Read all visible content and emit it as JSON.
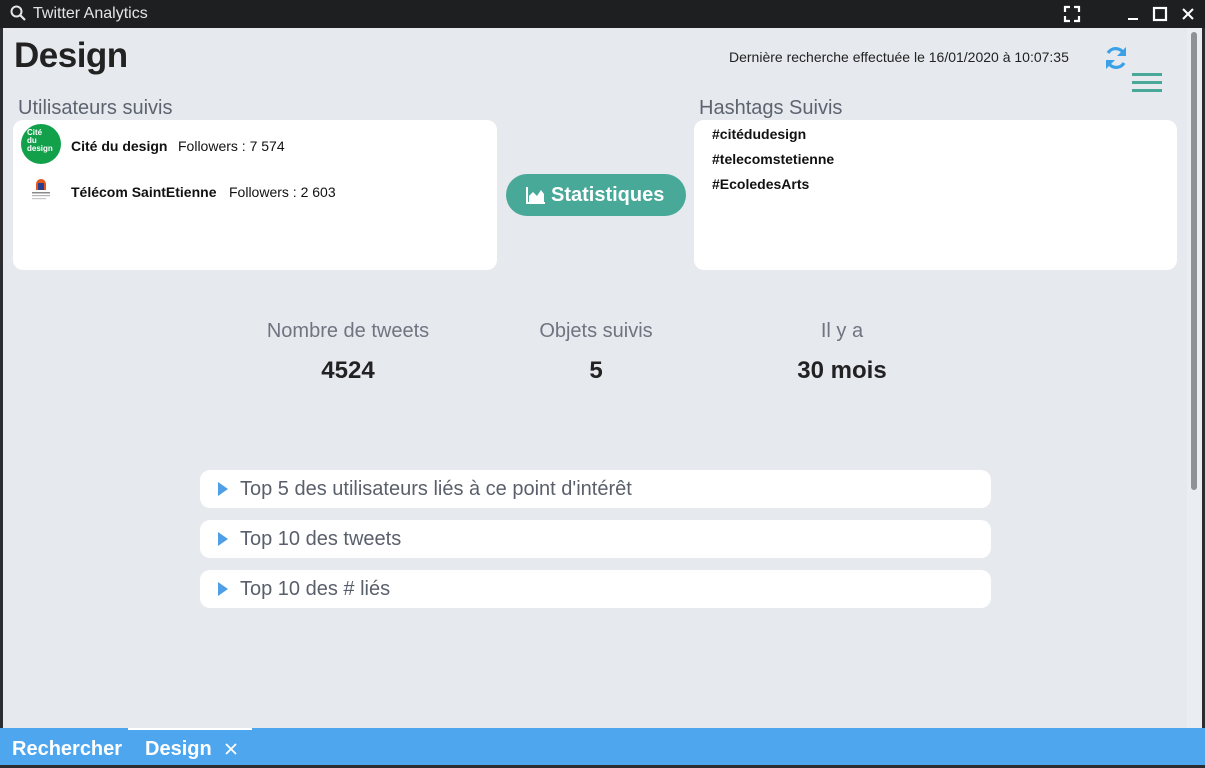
{
  "window": {
    "title": "Twitter Analytics",
    "icons": [
      "search-icon",
      "fullscreen-icon",
      "minimize-icon",
      "maximize-icon",
      "close-icon"
    ]
  },
  "header": {
    "title": "Design",
    "last_search": "Dernière recherche effectuée le 16/01/2020 à 10:07:35",
    "icons": [
      "refresh-icon",
      "hamburger-menu-icon"
    ]
  },
  "users": {
    "title": "Utilisateurs suivis",
    "items": [
      {
        "name": "Cité du design",
        "followers": "Followers : 7 574",
        "avatar_text": [
          "Cité",
          "du",
          "design"
        ],
        "avatar_color": "#12a04b"
      },
      {
        "name": "Télécom SaintEtienne",
        "followers": "Followers : 2 603",
        "avatar_text": [],
        "avatar_color": "#ffffff"
      }
    ]
  },
  "stats_button": {
    "label": "Statistiques",
    "icon": "area-chart-icon"
  },
  "hashtags": {
    "title": "Hashtags Suivis",
    "items": [
      "#citédudesign",
      "#telecomstetienne",
      "#EcoledesArts"
    ]
  },
  "kpis": [
    {
      "label": "Nombre de tweets",
      "value": "4524"
    },
    {
      "label": "Objets suivis",
      "value": "5"
    },
    {
      "label": "Il y a",
      "value": "30 mois"
    }
  ],
  "accordions": [
    "Top 5 des utilisateurs liés à ce point d'intérêt",
    "Top 10 des tweets",
    "Top 10 des # liés"
  ],
  "tabs": [
    {
      "label": "Rechercher",
      "active": false
    },
    {
      "label": "Design",
      "active": true
    }
  ],
  "colors": {
    "accent": "#48a999",
    "tabbar": "#4ea6ee",
    "refresh": "#3aa1e8",
    "background": "#e6e9ee",
    "titlebar": "#1d1f21"
  }
}
